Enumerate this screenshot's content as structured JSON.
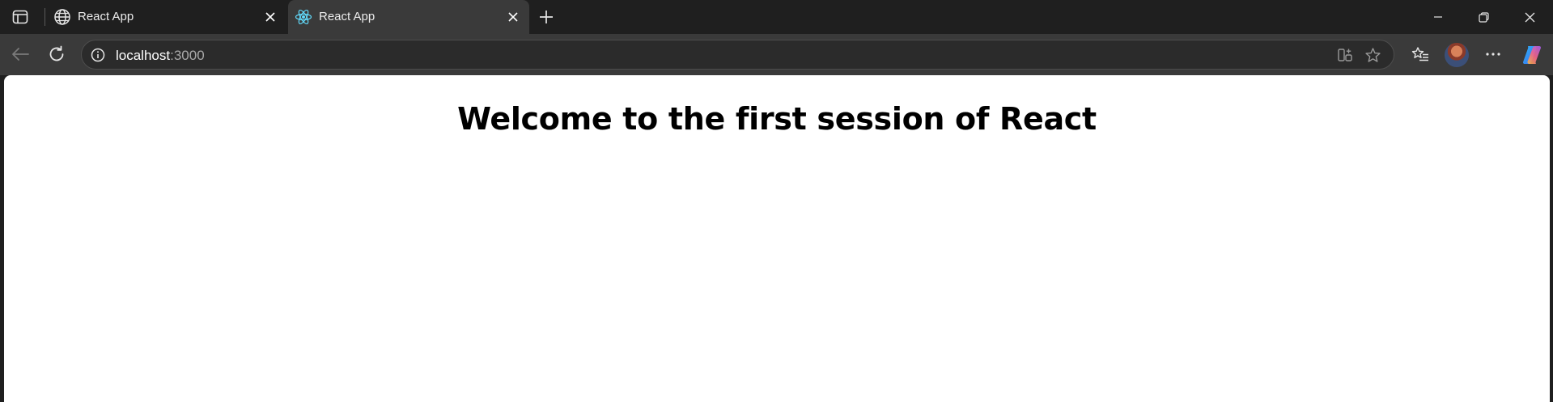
{
  "browser": {
    "tabs": [
      {
        "title": "React App",
        "favicon": "globe-icon",
        "active": false
      },
      {
        "title": "React App",
        "favicon": "react-logo-icon",
        "active": true
      }
    ],
    "new_tab_icon": "plus-icon",
    "window_controls": [
      "minimize-icon",
      "restore-icon",
      "close-icon"
    ]
  },
  "toolbar": {
    "back_icon": "back-arrow-icon",
    "reload_icon": "reload-icon",
    "address": {
      "host": "localhost",
      "port": ":3000",
      "info_icon": "info-icon"
    },
    "right_icons": [
      "favorites-icon",
      "profile-avatar",
      "more-icon",
      "copilot-icon"
    ]
  },
  "page": {
    "heading": "Welcome to the first session of React"
  },
  "colors": {
    "chrome_dark": "#1f1f1f",
    "toolbar": "#3a3a3a",
    "page_bg": "#ffffff",
    "react_blue": "#61dafb"
  }
}
